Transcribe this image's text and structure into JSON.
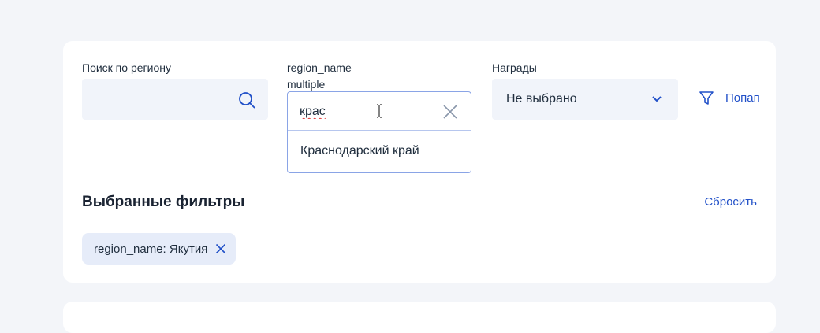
{
  "filters": {
    "region_search": {
      "label": "Поиск по региону",
      "value": "",
      "icon": "search-icon"
    },
    "region_name": {
      "label": "region_name",
      "sublabel": "multiple",
      "input_value": "крас",
      "options": [
        "Краснодарский край"
      ],
      "clear_icon": "close-icon"
    },
    "awards": {
      "label": "Награды",
      "selected": "Не выбрано",
      "icon": "chevron-down-icon"
    },
    "popular_link": {
      "label": "Попап",
      "icon": "filter-icon"
    }
  },
  "selected_filters": {
    "title": "Выбранные фильтры",
    "reset_label": "Сбросить",
    "chips": [
      {
        "label": "region_name: Якутия",
        "remove_icon": "close-icon"
      }
    ]
  },
  "colors": {
    "accent": "#2150c8",
    "field_bg": "#f1f4fa",
    "chip_bg": "#e6ecf9",
    "page_bg": "#f3f5f9",
    "focus_border": "#8aa4e6"
  }
}
